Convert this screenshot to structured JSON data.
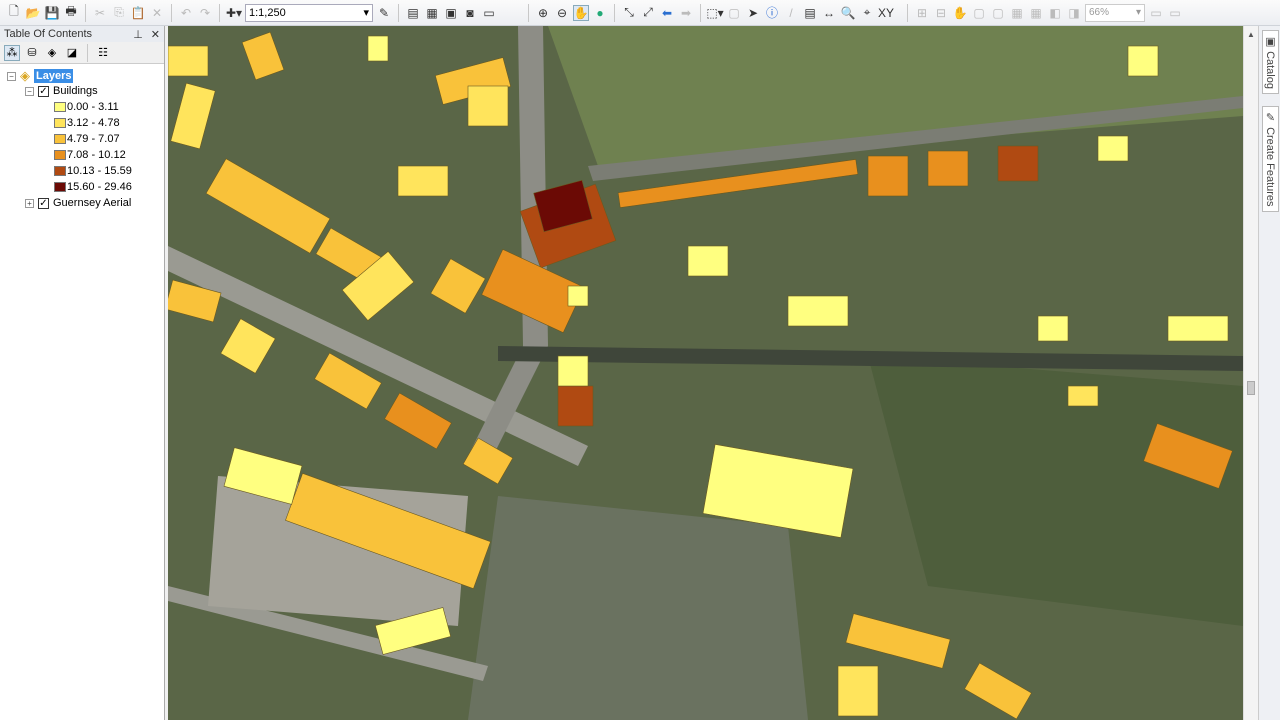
{
  "toolbar": {
    "scale": "1:1,250",
    "layout_zoom": "66%"
  },
  "toc": {
    "title": "Table Of Contents",
    "root": "Layers",
    "layers": [
      {
        "name": "Buildings",
        "checked": true,
        "expanded": true,
        "classes": [
          {
            "label": "0.00 - 3.11",
            "color": "#ffff80"
          },
          {
            "label": "3.12 - 4.78",
            "color": "#ffe45c"
          },
          {
            "label": "4.79 - 7.07",
            "color": "#f9c23a"
          },
          {
            "label": "7.08 - 10.12",
            "color": "#e8901e"
          },
          {
            "label": "10.13 - 15.59",
            "color": "#b04a12"
          },
          {
            "label": "15.60 - 29.46",
            "color": "#6b0a05"
          }
        ]
      },
      {
        "name": "Guernsey Aerial",
        "checked": true,
        "expanded": false
      }
    ]
  },
  "dock": {
    "tabs": [
      "Catalog",
      "Create Features"
    ]
  }
}
